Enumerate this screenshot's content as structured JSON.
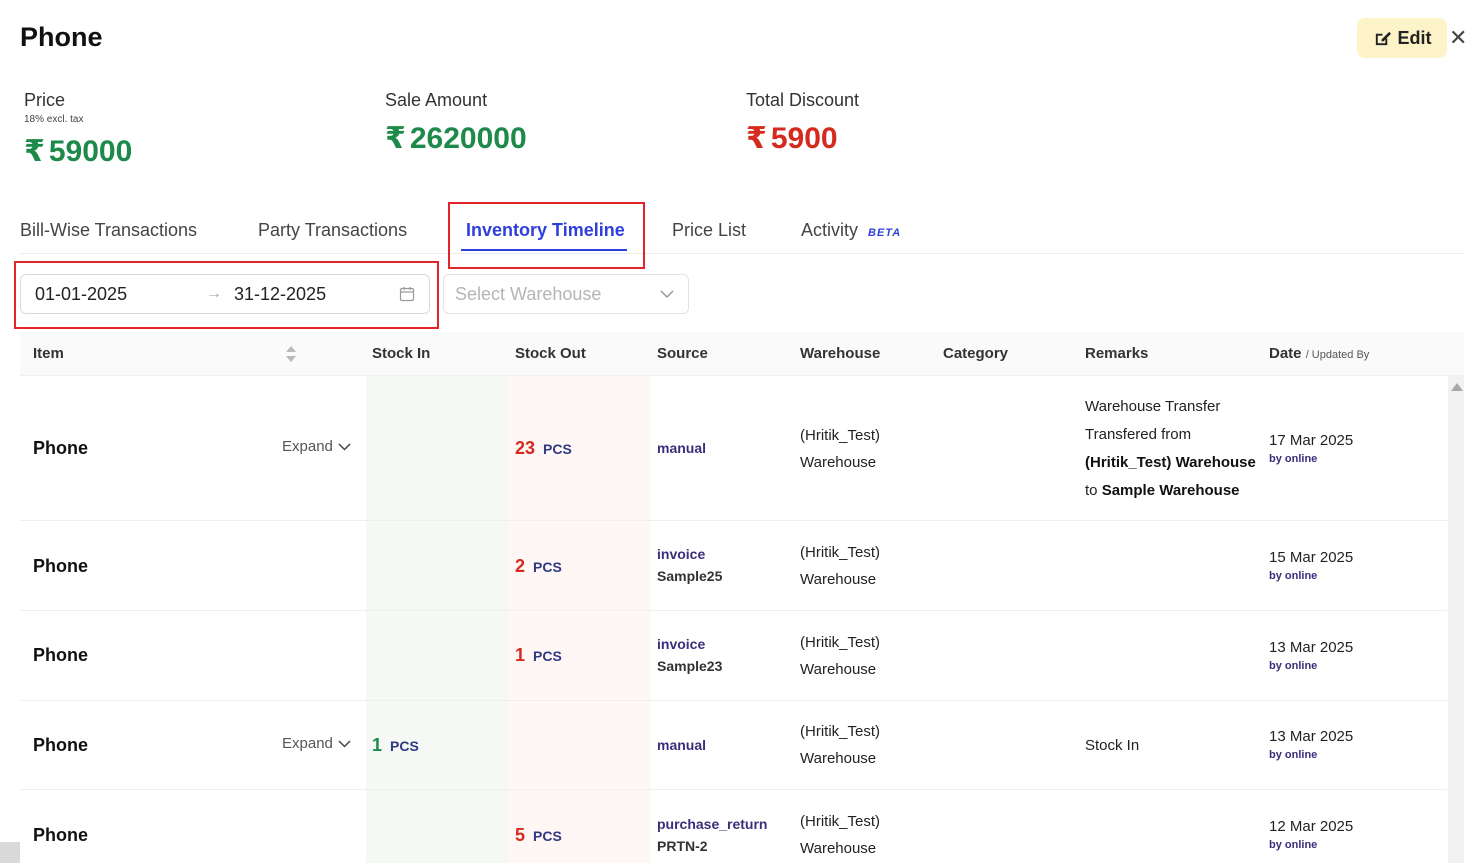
{
  "header": {
    "title": "Phone",
    "edit_label": "Edit",
    "close_glyph": "✕"
  },
  "stats": {
    "price_label": "Price",
    "price_sub": "18% excl. tax",
    "price_value": "59000",
    "sale_label": "Sale Amount",
    "sale_value": "2620000",
    "discount_label": "Total Discount",
    "discount_value": "5900",
    "currency": "₹"
  },
  "tabs": {
    "bill_wise": "Bill-Wise Transactions",
    "party": "Party Transactions",
    "inventory": "Inventory Timeline",
    "price_list": "Price List",
    "activity": "Activity",
    "beta": "BETA",
    "active": "Inventory Timeline"
  },
  "filters": {
    "date_from": "01-01-2025",
    "date_to": "31-12-2025",
    "warehouse_placeholder": "Select Warehouse"
  },
  "table": {
    "columns": {
      "item": "Item",
      "stock_in": "Stock In",
      "stock_out": "Stock Out",
      "source": "Source",
      "warehouse": "Warehouse",
      "category": "Category",
      "remarks": "Remarks",
      "date": "Date",
      "updated_by": "/ Updated By"
    },
    "expand_label": "Expand",
    "rows": [
      {
        "item": "Phone",
        "expand": true,
        "stock_in": "",
        "stock_out": "23",
        "unit": "PCS",
        "source_type": "manual",
        "source_ref": "",
        "warehouse_line1": "(Hritik_Test)",
        "warehouse_line2": "Warehouse",
        "remarks_line1": "Warehouse Transfer",
        "remarks_line2": "Transfered from",
        "remarks_bold1": "(Hritik_Test) Warehouse",
        "remarks_to": "to",
        "remarks_bold2": "Sample Warehouse",
        "date": "17 Mar 2025",
        "by": "by online"
      },
      {
        "item": "Phone",
        "expand": false,
        "stock_in": "",
        "stock_out": "2",
        "unit": "PCS",
        "source_type": "invoice",
        "source_ref": "Sample25",
        "warehouse_line1": "(Hritik_Test)",
        "warehouse_line2": "Warehouse",
        "date": "15 Mar 2025",
        "by": "by online"
      },
      {
        "item": "Phone",
        "expand": false,
        "stock_in": "",
        "stock_out": "1",
        "unit": "PCS",
        "source_type": "invoice",
        "source_ref": "Sample23",
        "warehouse_line1": "(Hritik_Test)",
        "warehouse_line2": "Warehouse",
        "date": "13 Mar 2025",
        "by": "by online"
      },
      {
        "item": "Phone",
        "expand": true,
        "stock_in": "1",
        "stock_out": "",
        "unit": "PCS",
        "source_type": "manual",
        "source_ref": "",
        "warehouse_line1": "(Hritik_Test)",
        "warehouse_line2": "Warehouse",
        "remarks_line1": "Stock In",
        "date": "13 Mar 2025",
        "by": "by online"
      },
      {
        "item": "Phone",
        "expand": false,
        "stock_in": "",
        "stock_out": "5",
        "unit": "PCS",
        "source_type": "purchase_return",
        "source_ref": "PRTN-2",
        "warehouse_line1": "(Hritik_Test)",
        "warehouse_line2": "Warehouse",
        "date": "12 Mar 2025",
        "by": "by online"
      }
    ]
  },
  "colors": {
    "accent": "#2f3fdb",
    "positive": "#1e8a4a",
    "negative": "#d42b1e",
    "highlight_box": "#e0262b"
  }
}
